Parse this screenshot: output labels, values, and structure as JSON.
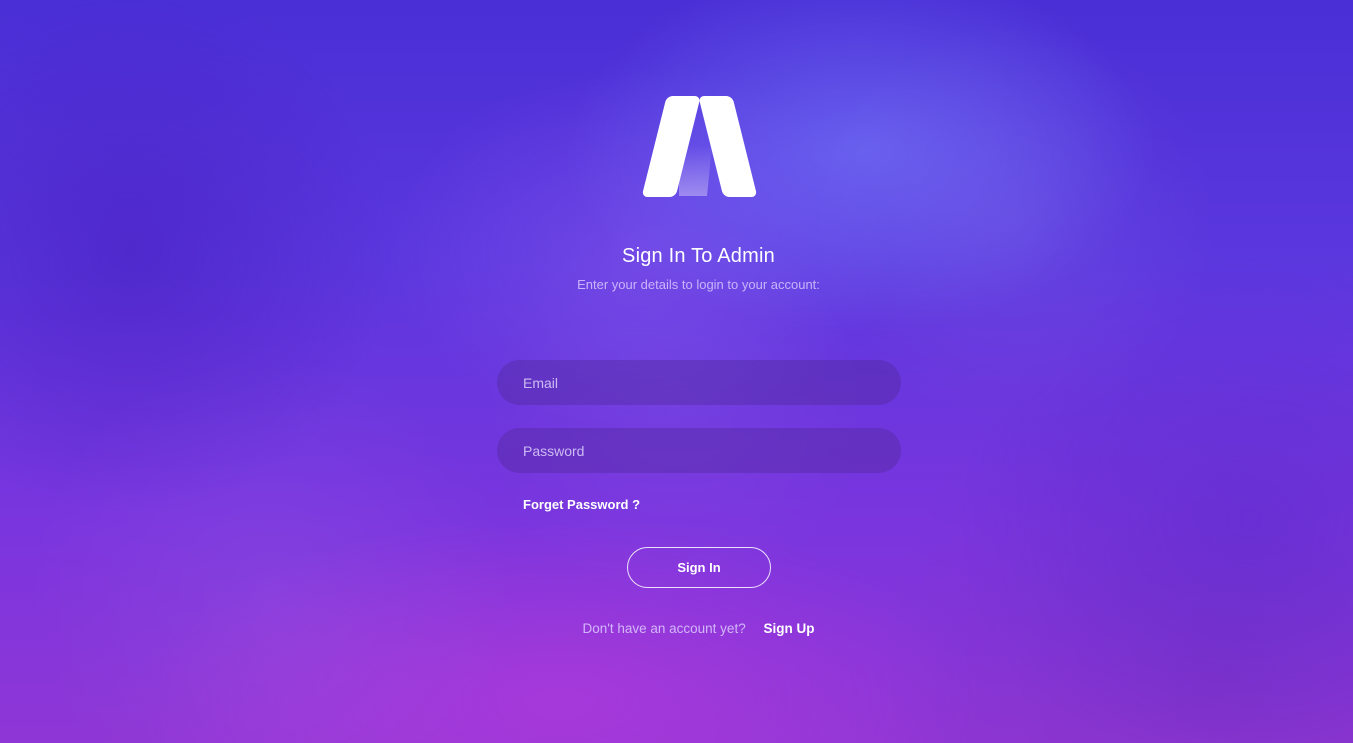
{
  "brand": {
    "logo_icon": "m-letter-logo-icon"
  },
  "login": {
    "title": "Sign In To Admin",
    "subtitle": "Enter your details to login to your account:",
    "email_placeholder": "Email",
    "password_placeholder": "Password",
    "forgot_label": "Forget Password ?",
    "signin_label": "Sign In",
    "no_account_text": "Don't have an account yet?",
    "signup_label": "Sign Up"
  },
  "colors": {
    "background_top": "#4a2fd6",
    "background_bottom": "#8f36d6",
    "text": "#ffffff"
  }
}
